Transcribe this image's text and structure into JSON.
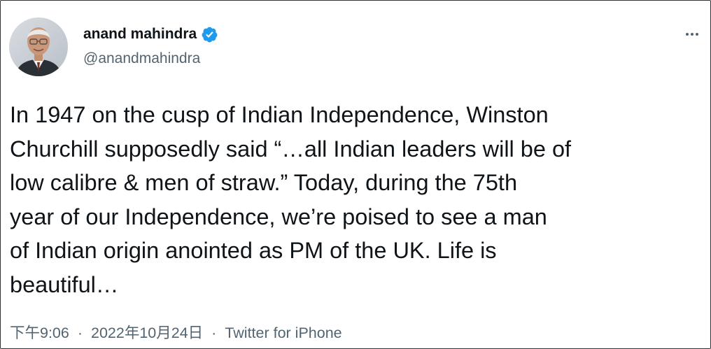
{
  "author": {
    "display_name": "anand mahindra",
    "handle": "@anandmahindra",
    "verified": true
  },
  "tweet": {
    "lines": [
      "In 1947 on the cusp of Indian Independence, Winston",
      "Churchill supposedly said “…all Indian leaders will be of",
      "low calibre & men of straw.” Today, during the 75th",
      "year of our Independence, we’re poised to see a man",
      "of Indian origin anointed as PM of the UK. Life is",
      "beautiful…"
    ]
  },
  "meta": {
    "time": "下午9:06",
    "separator": "·",
    "date": "2022年10月24日",
    "source": "Twitter for iPhone"
  },
  "icons": {
    "verified_badge": "verified-badge-icon",
    "more": "more-options-icon"
  },
  "colors": {
    "text_primary": "#0f1419",
    "text_secondary": "#536471",
    "verified_blue": "#1d9bf0",
    "border": "#2f3336"
  }
}
